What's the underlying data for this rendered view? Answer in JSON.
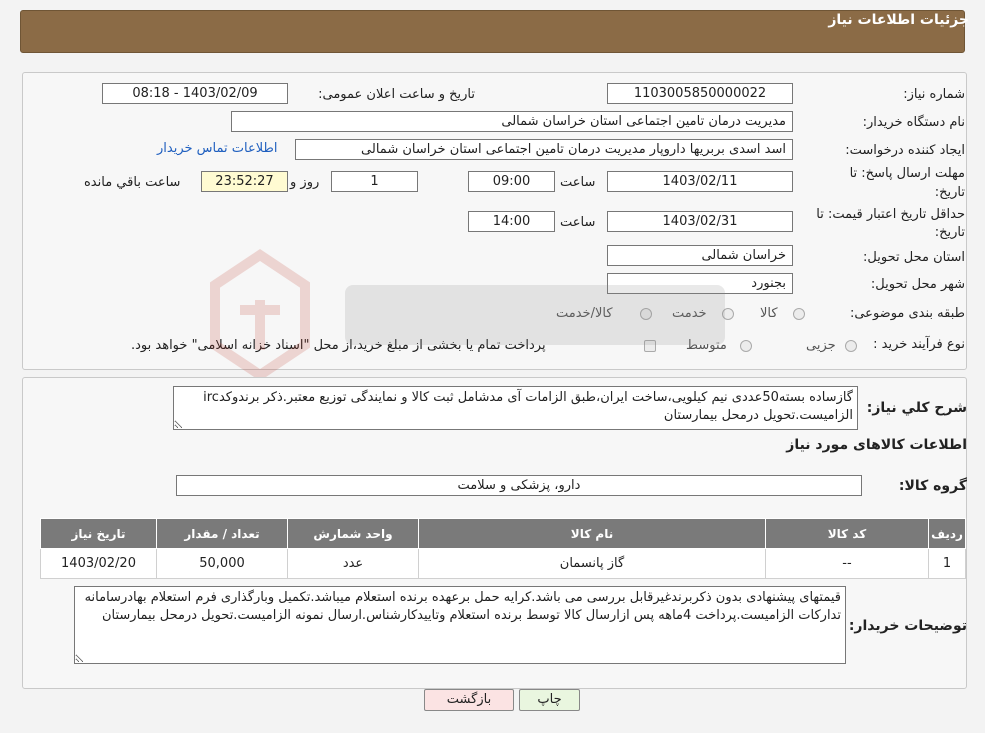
{
  "header": {
    "title": "جزئیات اطلاعات نیاز"
  },
  "form": {
    "need_number_label": "شماره نیاز:",
    "need_number": "1103005850000022",
    "announce_label": "تاریخ و ساعت اعلان عمومی:",
    "announce_value": "1403/02/09 - 08:18",
    "buyer_label": "نام دستگاه خریدار:",
    "buyer_value": "مدیریت درمان تامین اجتماعی استان خراسان شمالی",
    "creator_label": "ایجاد کننده درخواست:",
    "creator_value": "اسد اسدی بربریها داروپار مدیریت درمان تامین اجتماعی استان خراسان شمالی",
    "contact_link": "اطلاعات تماس خریدار",
    "deadline_label_1": "مهلت ارسال پاسخ: تا",
    "deadline_label_2": "تاریخ:",
    "deadline_date": "1403/02/11",
    "time_label": "ساعت",
    "deadline_time": "09:00",
    "days_value": "1",
    "days_label": "روز و",
    "remaining_time": "23:52:27",
    "remaining_label": "ساعت باقي مانده",
    "validity_label_1": "حداقل تاریخ اعتبار قیمت: تا",
    "validity_label_2": "تاریخ:",
    "validity_date": "1403/02/31",
    "validity_time": "14:00",
    "province_label": "استان محل تحویل:",
    "province_value": "خراسان شمالی",
    "city_label": "شهر محل تحویل:",
    "city_value": "بجنورد",
    "category_label": "طبقه بندی موضوعی:",
    "category_options": [
      "کالا",
      "خدمت",
      "کالا/خدمت"
    ],
    "process_label": "نوع فرآیند خرید :",
    "process_options": [
      "جزیی",
      "متوسط"
    ],
    "process_note": "پرداخت تمام یا بخشی از مبلغ خرید،از محل \"اسناد خزانه اسلامی\" خواهد بود."
  },
  "summary": {
    "label": "شرح کلي نیاز:",
    "text": "گازساده بسته50عددی نیم کیلویی،ساخت ایران،طبق الزامات آی مدشامل ثبت کالا و نمایندگی توزیع معتبر.ذکر برندوکدirc الزامیست.تحویل درمحل بیمارستان"
  },
  "goods": {
    "section_title": "اطلاعات کالاهای مورد نیاز",
    "group_label": "گروه کالا:",
    "group_value": "دارو، پزشکی و سلامت",
    "columns": [
      "ردیف",
      "کد کالا",
      "نام کالا",
      "واحد شمارش",
      "تعداد / مقدار",
      "تاریخ نیاز"
    ],
    "rows": [
      [
        "1",
        "--",
        "گاز پانسمان",
        "عدد",
        "50,000",
        "1403/02/20"
      ]
    ]
  },
  "buyer_notes": {
    "label": "توضیحات خریدار:",
    "text": "قیمتهای پیشنهادی بدون ذکربرندغیرقابل بررسی می باشد.کرایه حمل برعهده برنده استعلام میباشد.تکمیل وبارگذاری فرم استعلام بهادرسامانه تدارکات الزامیست.پرداخت 4ماهه پس ازارسال کالا توسط برنده استعلام وتاییدکارشناس.ارسال نمونه الزامیست.تحویل درمحل بیمارستان"
  },
  "buttons": {
    "print": "چاپ",
    "back": "بازگشت"
  },
  "colors": {
    "header": "#8b6b46",
    "table_header": "#7a7a7a",
    "back_button": "#fbe3e3",
    "print_button": "#e9f6df",
    "remaining_bg": "#fffbd2"
  }
}
